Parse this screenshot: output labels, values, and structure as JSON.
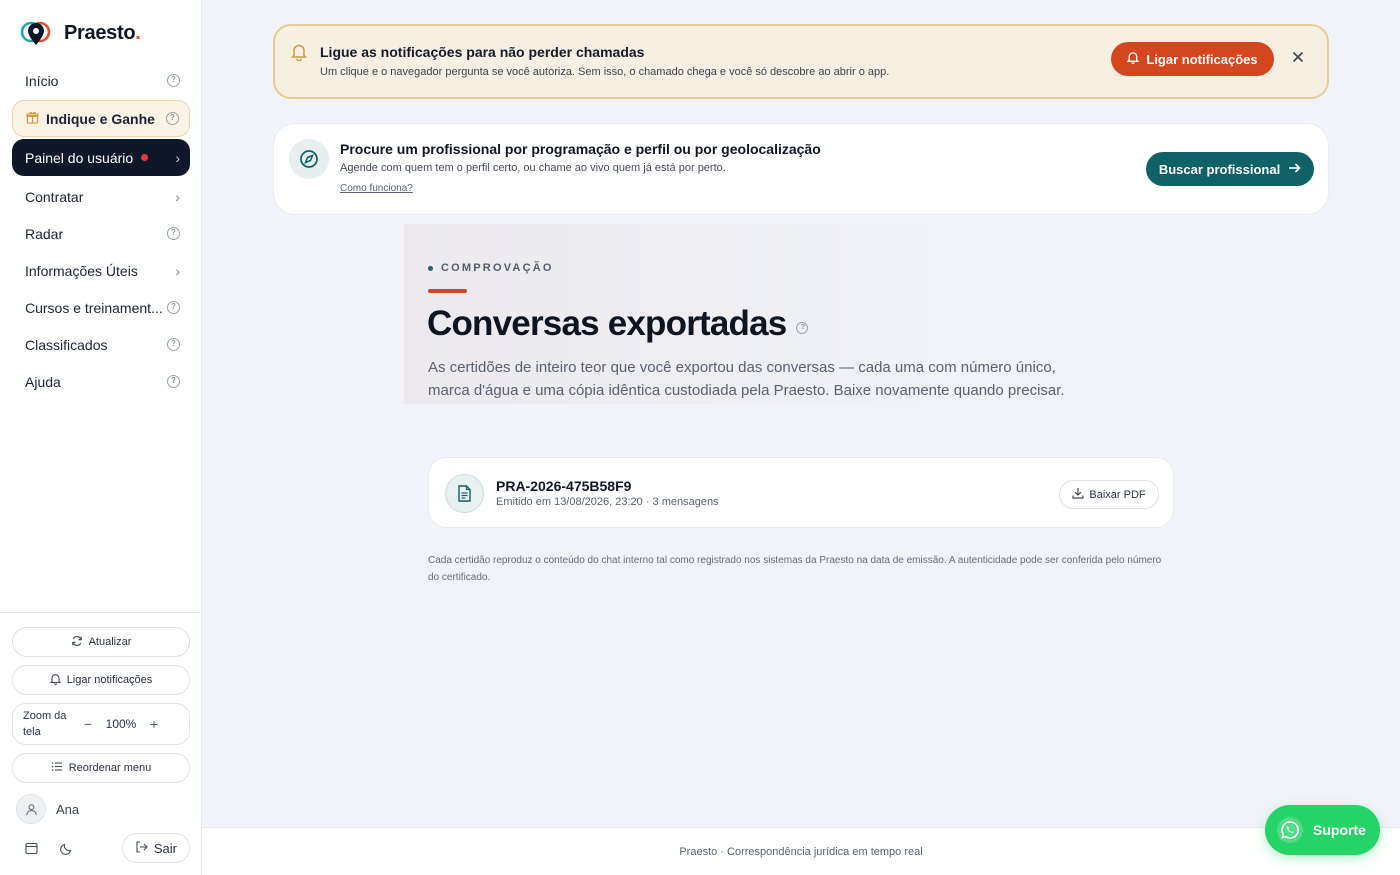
{
  "brand": {
    "name": "Praesto",
    "dot": "."
  },
  "sidebar": {
    "items": [
      {
        "label": "Início",
        "trailing": "help"
      },
      {
        "label": "Indique e Ganhe",
        "trailing": "help",
        "style": "promo"
      },
      {
        "label": "Painel do usuário",
        "trailing": "chevron",
        "style": "active",
        "badge": "red-dot"
      },
      {
        "label": "Contratar",
        "trailing": "chevron"
      },
      {
        "label": "Radar",
        "trailing": "help"
      },
      {
        "label": "Informações Úteis",
        "trailing": "chevron"
      },
      {
        "label": "Cursos e treinament...",
        "trailing": "help"
      },
      {
        "label": "Classificados",
        "trailing": "help"
      },
      {
        "label": "Ajuda",
        "trailing": "help"
      }
    ],
    "refresh_label": "Atualizar",
    "notif_label": "Ligar notificações",
    "zoom": {
      "label": "Zoom da tela",
      "minus": "−",
      "value": "100%",
      "plus": "+"
    },
    "reorder_label": "Reordenar menu",
    "user_name": "Ana",
    "logout_label": "Sair"
  },
  "notification_banner": {
    "title": "Ligue as notificações para não perder chamadas",
    "subtitle": "Um clique e o navegador pergunta se você autoriza. Sem isso, o chamado chega e você só descobre ao abrir o app.",
    "cta_label": "Ligar notificações"
  },
  "search_card": {
    "title": "Procure um profissional por programação e perfil ou por geolocalização",
    "subtitle": "Agende com quem tem o perfil certo, ou chame ao vivo quem já está por perto.",
    "link": "Como funciona?",
    "cta_label": "Buscar profissional"
  },
  "page": {
    "eyebrow": "COMPROVAÇÃO",
    "title": "Conversas exportadas",
    "description": "As certidões de inteiro teor que você exportou das conversas — cada uma com número único, marca d'água e uma cópia idêntica custodiada pela Praesto. Baixe novamente quando precisar."
  },
  "certificates": [
    {
      "id": "PRA-2026-475B58F9",
      "meta": "Emitido em 13/08/2026, 23:20 · 3 mensagens",
      "download_label": "Baixar PDF"
    }
  ],
  "footnote": "Cada certidão reproduz o conteúdo do chat interno tal como registrado nos sistemas da Praesto na data de emissão. A autenticidade pode ser conferida pelo número do certificado.",
  "footer": "Praesto · Correspondência jurídica em tempo real",
  "support_label": "Suporte",
  "colors": {
    "accent_orange": "#d4471e",
    "teal": "#0e6164",
    "navy": "#0f1828",
    "whatsapp": "#25d366"
  }
}
